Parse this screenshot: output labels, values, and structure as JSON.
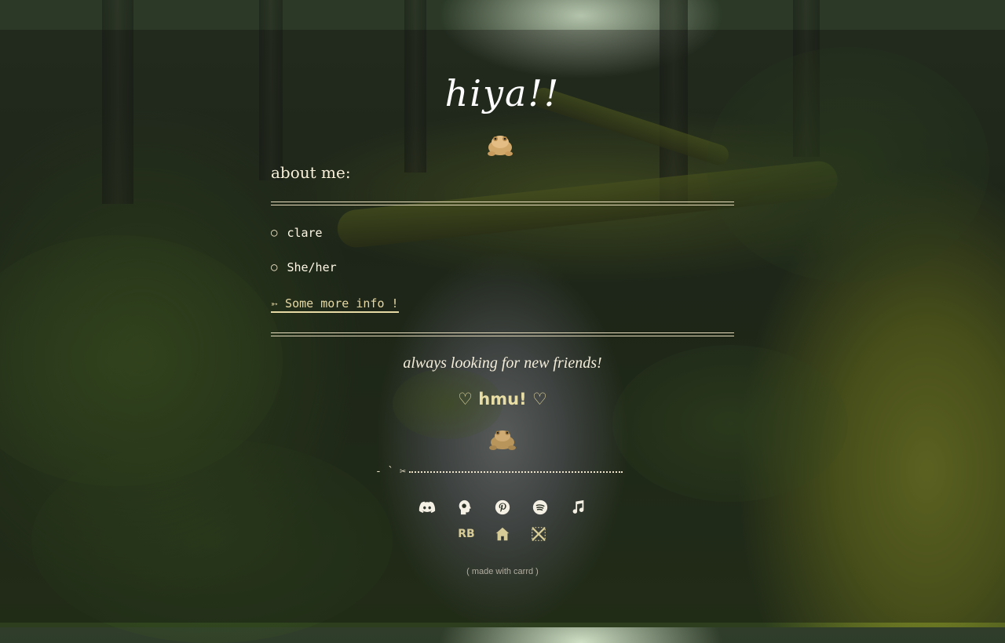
{
  "page": {
    "title": "hiya!!",
    "about_heading": "about me:",
    "about_items": [
      {
        "label": "clare"
      },
      {
        "label": "She/her"
      }
    ],
    "more_link": "➳ Some more info !",
    "tagline": "always looking for new friends!",
    "hmu": "♡ hmu! ♡",
    "divider_prefix": "- ` ✂",
    "social_icons_row1": [
      "discord-icon",
      "headspace-icon",
      "pinterest-icon",
      "spotify-icon",
      "music-note-icon"
    ],
    "social_icons_row2": [
      {
        "name": "rb-icon",
        "text": "RB"
      },
      {
        "name": "home-icon"
      },
      {
        "name": "crossed-swords-icon"
      }
    ],
    "footer": "( made with carrd )"
  },
  "colors": {
    "accent": "#e8dda4",
    "text": "#f4ecd8",
    "rule": "#e7dcbc"
  }
}
